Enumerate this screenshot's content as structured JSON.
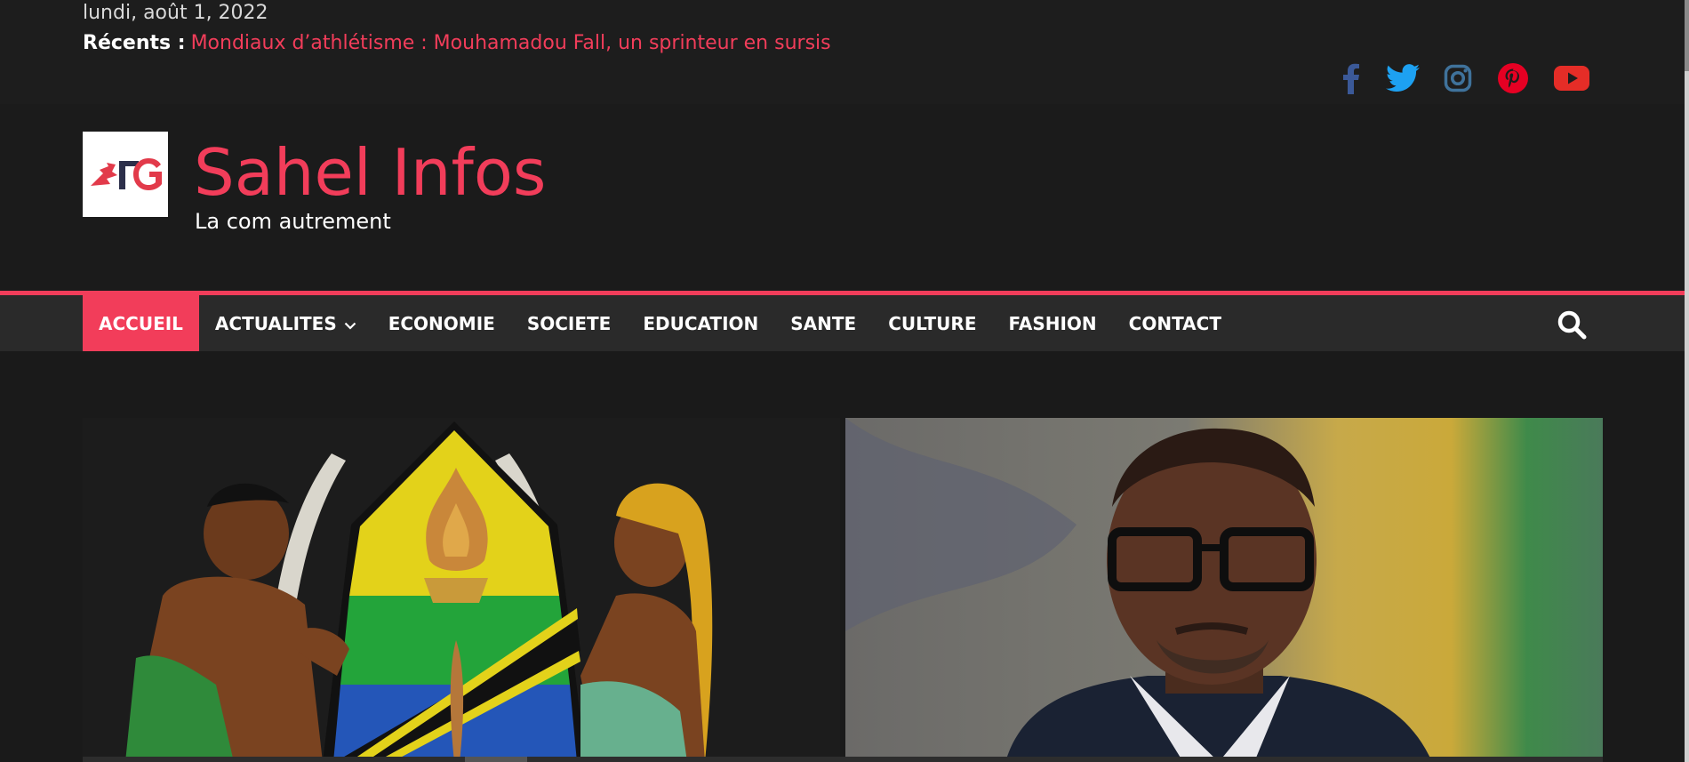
{
  "topbar": {
    "date": "lundi, août 1, 2022",
    "recent_label": "Récents :",
    "recent_link": "Mondiaux d’athlétisme : Mouhamadou Fall, un sprinteur en sursis"
  },
  "social": [
    {
      "name": "facebook-icon",
      "color": "#3b5998"
    },
    {
      "name": "twitter-icon",
      "color": "#1da1f2"
    },
    {
      "name": "instagram-icon",
      "color": "#3f729b"
    },
    {
      "name": "pinterest-icon",
      "color": "#e60023"
    },
    {
      "name": "youtube-icon",
      "color": "#e52d27"
    }
  ],
  "header": {
    "logo_text_1": "ΓG",
    "site_title": "Sahel Infos",
    "tagline": "La com autrement"
  },
  "nav": {
    "items": [
      {
        "label": "ACCUEIL"
      },
      {
        "label": "ACTUALITES"
      },
      {
        "label": "ECONOMIE"
      },
      {
        "label": "SOCIETE"
      },
      {
        "label": "EDUCATION"
      },
      {
        "label": "SANTE"
      },
      {
        "label": "CULTURE"
      },
      {
        "label": "FASHION"
      },
      {
        "label": "CONTACT"
      }
    ]
  },
  "colors": {
    "accent": "#f23d5a",
    "background": "#1a1a1a"
  }
}
